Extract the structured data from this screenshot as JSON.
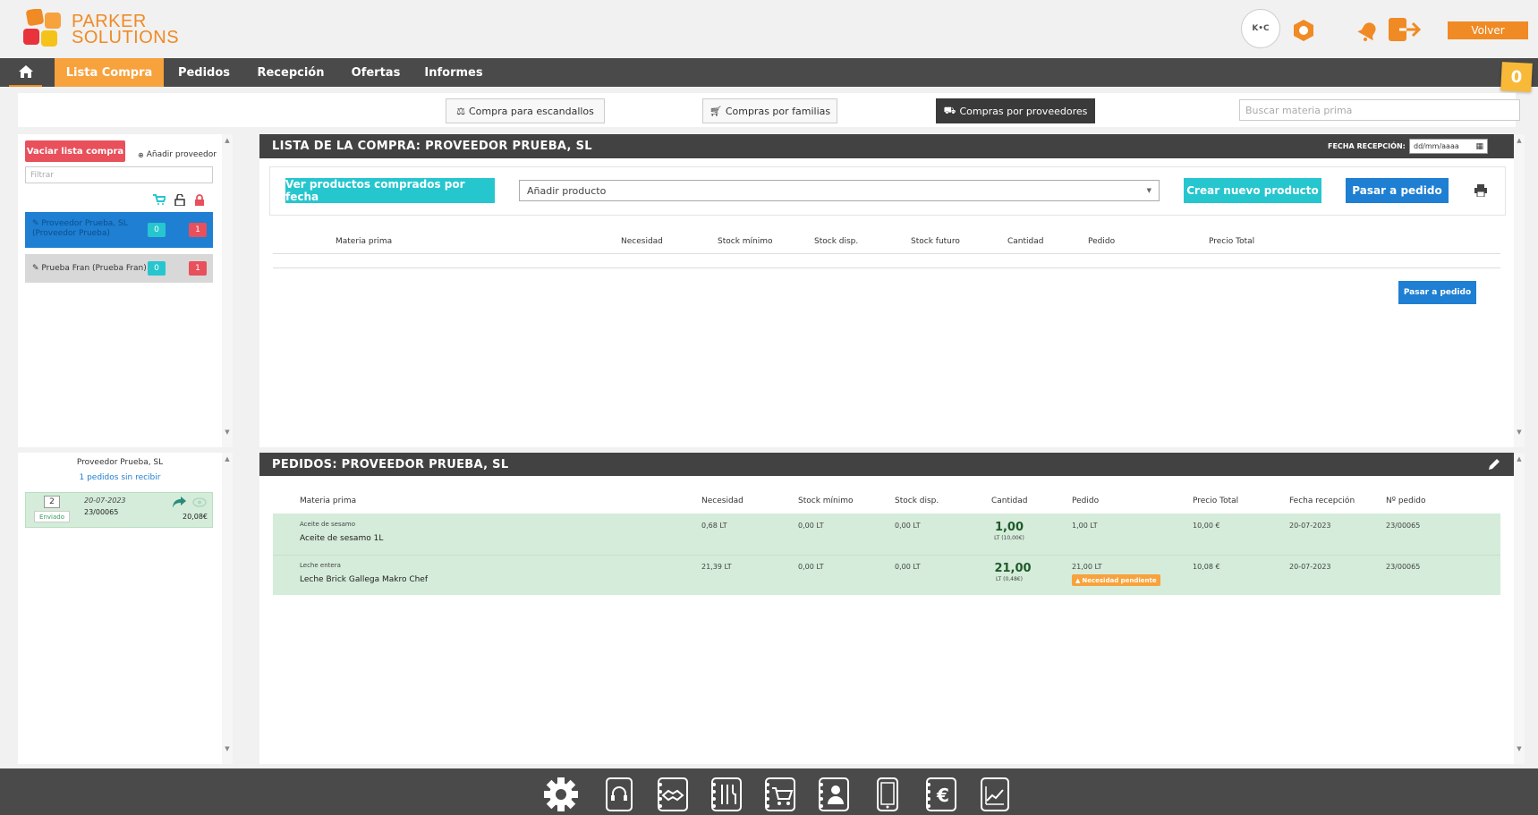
{
  "header": {
    "brand_line1": "PARKER",
    "brand_line2": "SOLUTIONS",
    "avatar_text": "K•C",
    "volver_label": "Volver",
    "notification_count": "0"
  },
  "nav": {
    "items": [
      {
        "label": "Lista Compra"
      },
      {
        "label": "Pedidos"
      },
      {
        "label": "Recepción"
      },
      {
        "label": "Ofertas"
      },
      {
        "label": "Informes"
      }
    ]
  },
  "subbar": {
    "tabs": [
      {
        "label": "Compra para escandallos"
      },
      {
        "label": "Compras por familias"
      },
      {
        "label": "Compras por proveedores"
      }
    ],
    "search_placeholder": "Buscar materia prima"
  },
  "sidebar": {
    "vaciar_label": "Vaciar lista compra",
    "anadir_label": "Añadir proveedor",
    "filter_placeholder": "Filtrar",
    "providers": [
      {
        "name": "Proveedor Prueba, SL (Proveedor Prueba)",
        "count_a": "0",
        "count_b": "1"
      },
      {
        "name": "Prueba Fran (Prueba Fran)",
        "count_a": "0",
        "count_b": "1"
      }
    ]
  },
  "lista": {
    "title": "LISTA DE LA COMPRA: PROVEEDOR PRUEBA, SL",
    "fecha_label": "FECHA RECEPCIÓN:",
    "fecha_placeholder": "dd/mm/aaaa",
    "ver_productos_label": "Ver productos comprados por fecha",
    "anadir_producto_label": "Añadir producto",
    "crear_label": "Crear nuevo producto",
    "pasar_label": "Pasar a pedido",
    "pasar_small_label": "Pasar a pedido",
    "columns": [
      "Materia prima",
      "Necesidad",
      "Stock mínimo",
      "Stock disp.",
      "Stock futuro",
      "Cantidad",
      "Pedido",
      "Precio Total"
    ]
  },
  "left_orders": {
    "provider": "Proveedor Prueba, SL",
    "pending_link": "1 pedidos sin recibir",
    "order": {
      "count": "2",
      "status": "Enviado",
      "date": "20-07-2023",
      "number": "23/00065",
      "total": "20,08€"
    }
  },
  "pedidos": {
    "title": "PEDIDOS: PROVEEDOR PRUEBA, SL",
    "columns": [
      "Materia prima",
      "Necesidad",
      "Stock mínimo",
      "Stock disp.",
      "Cantidad",
      "Pedido",
      "Precio Total",
      "Fecha recepción",
      "Nº pedido"
    ],
    "rows": [
      {
        "subname": "Aceite de sesamo",
        "name": "Aceite de sesamo 1L",
        "necesidad": "0,68 LT",
        "stock_min": "0,00 LT",
        "stock_disp": "0,00 LT",
        "cantidad": "1,00",
        "cantidad_sub": "LT (10,00€)",
        "pedido": "1,00 LT",
        "precio": "10,00 €",
        "fecha": "20-07-2023",
        "num": "23/00065",
        "badge": ""
      },
      {
        "subname": "Leche entera",
        "name": "Leche Brick Gallega Makro Chef",
        "necesidad": "21,39 LT",
        "stock_min": "0,00 LT",
        "stock_disp": "0,00 LT",
        "cantidad": "21,00",
        "cantidad_sub": "LT (0,48€)",
        "pedido": "21,00 LT",
        "precio": "10,08 €",
        "fecha": "20-07-2023",
        "num": "23/00065",
        "badge": "Necesidad pendiente"
      }
    ]
  },
  "bottom_icons": [
    "settings-icon",
    "support-icon",
    "handshake-icon",
    "menu-icon",
    "cart-icon",
    "contacts-icon",
    "mobile-icon",
    "euro-icon",
    "chart-icon"
  ],
  "colors": {
    "orange": "#f08a24",
    "dark": "#4a4a4a",
    "teal": "#26c6cf",
    "blue": "#1e7fd3",
    "red": "#e8505b",
    "green_row": "#d4ecd9"
  }
}
